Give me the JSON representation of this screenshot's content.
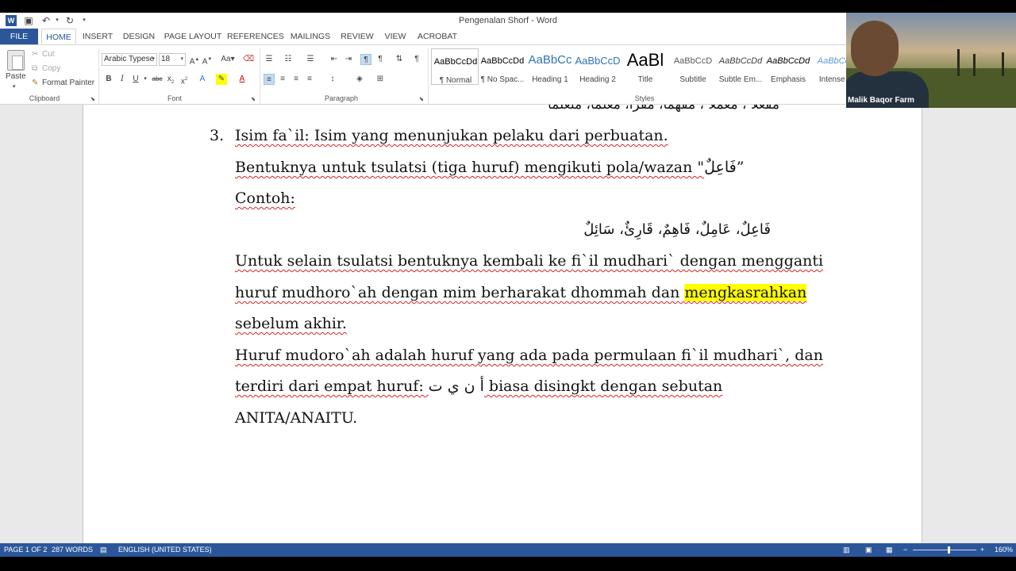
{
  "window": {
    "title": "Pengenalan Shorf - Word",
    "app_icon": "W"
  },
  "qat": {
    "save_icon": "save-icon",
    "undo_icon": "undo-icon",
    "redo_icon": "redo-icon"
  },
  "tabs": [
    "FILE",
    "HOME",
    "INSERT",
    "DESIGN",
    "PAGE LAYOUT",
    "REFERENCES",
    "MAILINGS",
    "REVIEW",
    "VIEW",
    "ACROBAT"
  ],
  "ribbon": {
    "clipboard": {
      "label": "Clipboard",
      "paste": "Paste",
      "cut": "Cut",
      "copy": "Copy",
      "format_painter": "Format Painter"
    },
    "font": {
      "label": "Font",
      "font_name": "Arabic Typese",
      "font_size": "18"
    },
    "paragraph": {
      "label": "Paragraph"
    },
    "styles": {
      "label": "Styles",
      "items": [
        {
          "sample": "AaBbCcDd",
          "name": "¶ Normal"
        },
        {
          "sample": "AaBbCcDd",
          "name": "¶ No Spac..."
        },
        {
          "sample": "AaBbCc",
          "name": "Heading 1"
        },
        {
          "sample": "AaBbCcD",
          "name": "Heading 2"
        },
        {
          "sample": "AaBl",
          "name": "Title"
        },
        {
          "sample": "AaBbCcD",
          "name": "Subtitle"
        },
        {
          "sample": "AaBbCcDd",
          "name": "Subtle Em..."
        },
        {
          "sample": "AaBbCcDd",
          "name": "Emphasis"
        },
        {
          "sample": "AaBbCcL",
          "name": "Intense E"
        }
      ]
    }
  },
  "document": {
    "partial_top": "مفعلا ، معملا ، مفهما، مقرأ، معلما، متعلما",
    "item_number": "3.",
    "line1": "Isim fa`il: Isim yang menunjukan pelaku dari perbuatan.",
    "line2_pre": "Bentuknya untuk tsulatsi (tiga huruf) mengikuti pola/wazan \"",
    "line2_arabic": "فَاعِلٌ",
    "line2_post": "”",
    "line3": "Contoh:",
    "line4_arabic": "فَاعِلٌ، عَامِلٌ، فَاهِمٌ، قَارِئٌ، سَائِلٌ",
    "line5": "Untuk selain tsulatsi bentuknya kembali ke fi`il mudhari`  dengan mengganti",
    "line6_pre": "huruf mudhoro`ah dengan mim berharakat dhommah dan ",
    "line6_highlight": "mengkasrahkan",
    "line7": "sebelum akhir.",
    "line8": "Huruf mudoro`ah adalah huruf yang ada pada permulaan fi`il mudhari`, dan",
    "line9_pre": "terdiri dari empat huruf: ",
    "line9_arabic": "أ ن ي ت",
    "line9_post": " biasa disingkt dengan sebutan",
    "line10": "ANITA/ANAITU."
  },
  "webcam": {
    "name": "Malik Baqor Farm"
  },
  "status": {
    "page": "PAGE 1 OF 2",
    "words": "287 WORDS",
    "language": "ENGLISH (UNITED STATES)",
    "zoom": "160%"
  }
}
